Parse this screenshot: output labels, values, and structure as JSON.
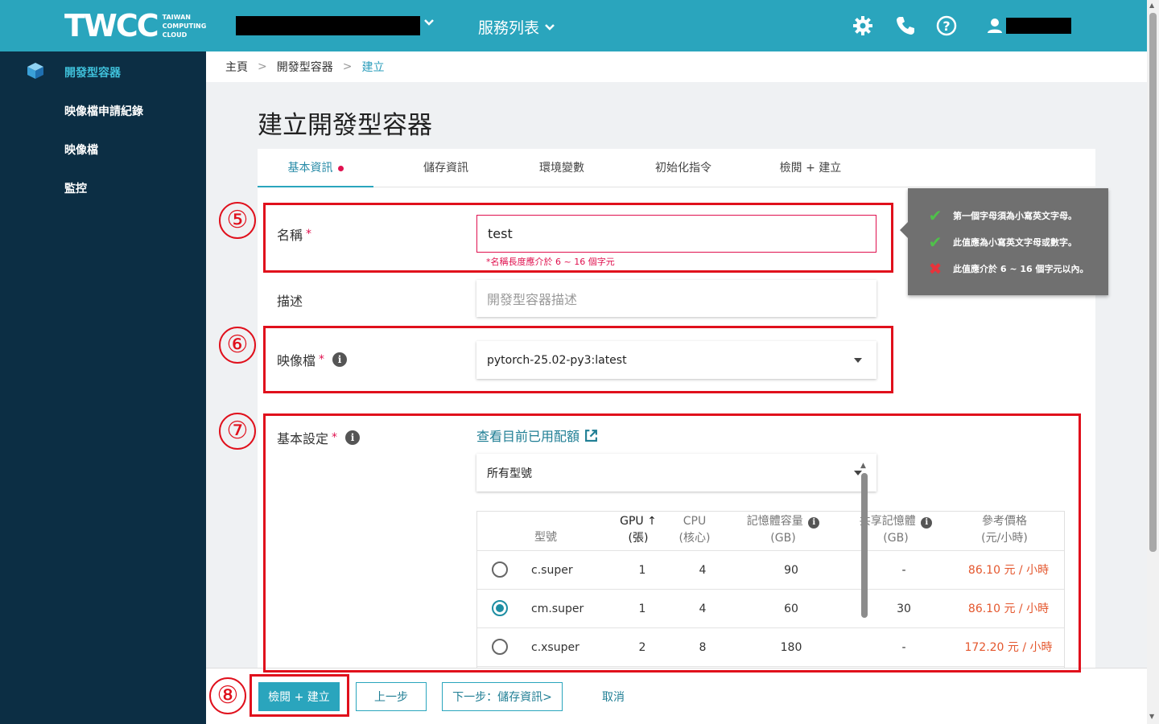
{
  "header": {
    "logo_main": "TWCC",
    "logo_sub_1": "TAIWAN",
    "logo_sub_2": "COMPUTING",
    "logo_sub_3": "CLOUD",
    "services_label": "服務列表"
  },
  "sidebar": {
    "items": [
      {
        "label": "開發型容器",
        "active": true
      },
      {
        "label": "映像檔申請紀錄"
      },
      {
        "label": "映像檔"
      },
      {
        "label": "監控"
      }
    ]
  },
  "breadcrumb": [
    "主頁",
    "開發型容器",
    "建立"
  ],
  "breadcrumb_sep": ">",
  "page_title": "建立開發型容器",
  "tabs": [
    "基本資訊",
    "儲存資訊",
    "環境變數",
    "初始化指令",
    "檢閱 + 建立"
  ],
  "form": {
    "name_label": "名稱",
    "name_value": "test",
    "name_error": "*名稱長度應介於 6 ~ 16 個字元",
    "desc_label": "描述",
    "desc_placeholder": "開發型容器描述",
    "image_label": "映像檔",
    "image_value": "pytorch-25.02-py3:latest",
    "basic_label": "基本設定",
    "quota_link": "查看目前已用配額",
    "model_filter": "所有型號",
    "required_mark": "*"
  },
  "table": {
    "headers": {
      "model": "型號",
      "gpu_1": "GPU",
      "gpu_2": "(張)",
      "cpu_1": "CPU",
      "cpu_2": "(核心)",
      "mem_1": "記憶體容量",
      "mem_2": "(GB)",
      "shm_1": "共享記憶體",
      "shm_2": "(GB)",
      "price_1": "參考價格",
      "price_2": "(元/小時)"
    },
    "rows": [
      {
        "model": "c.super",
        "gpu": "1",
        "cpu": "4",
        "mem": "90",
        "shm": "-",
        "price": "86.10 元 / 小時",
        "selected": false
      },
      {
        "model": "cm.super",
        "gpu": "1",
        "cpu": "4",
        "mem": "60",
        "shm": "30",
        "price": "86.10 元 / 小時",
        "selected": true
      },
      {
        "model": "c.xsuper",
        "gpu": "2",
        "cpu": "8",
        "mem": "180",
        "shm": "-",
        "price": "172.20 元 / 小時",
        "selected": false
      }
    ]
  },
  "tooltip": {
    "rules": [
      {
        "text": "第一個字母須為小寫英文字母。",
        "ok": true
      },
      {
        "text": "此值應為小寫英文字母或數字。",
        "ok": true
      },
      {
        "text": "此值應介於 6 ~ 16 個字元以內。",
        "ok": false
      }
    ]
  },
  "footer": {
    "review_button": "檢閱 + 建立",
    "prev_button": "上一步",
    "next_button": "下一步：儲存資訊>",
    "cancel_button": "取消"
  },
  "annotations": {
    "n5": "⑤",
    "n6": "⑥",
    "n7": "⑦",
    "n8": "⑧"
  },
  "colors": {
    "brand": "#2aa5bd",
    "sidebar": "#0c2e44",
    "error": "#e0114f",
    "price": "#e4572e",
    "annotation": "#e0101c"
  }
}
